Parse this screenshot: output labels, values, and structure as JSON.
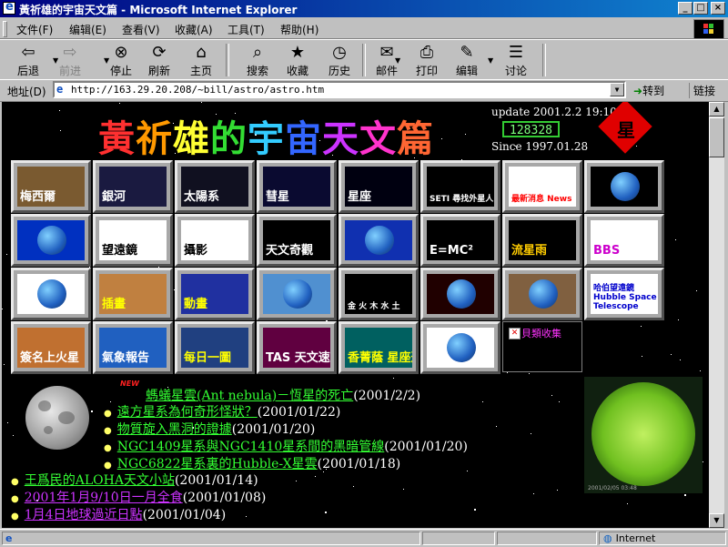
{
  "window": {
    "title": "黃祈雄的宇宙天文篇 - Microsoft Internet Explorer",
    "controls": [
      "_",
      "□",
      "×"
    ]
  },
  "menu": [
    "文件(F)",
    "编辑(E)",
    "查看(V)",
    "收藏(A)",
    "工具(T)",
    "帮助(H)"
  ],
  "toolbar": [
    {
      "label": "后退",
      "icon": "back-arrow-icon",
      "glyph": "⇦",
      "disabled": false
    },
    {
      "label": "前进",
      "icon": "forward-arrow-icon",
      "glyph": "⇨",
      "disabled": true
    },
    {
      "label": "停止",
      "icon": "stop-icon",
      "glyph": "⊗",
      "disabled": false
    },
    {
      "label": "刷新",
      "icon": "refresh-icon",
      "glyph": "⟳",
      "disabled": false
    },
    {
      "label": "主页",
      "icon": "home-icon",
      "glyph": "⌂",
      "disabled": false
    },
    {
      "label": "搜索",
      "icon": "search-icon",
      "glyph": "⌕",
      "disabled": false
    },
    {
      "label": "收藏",
      "icon": "favorites-icon",
      "glyph": "★",
      "disabled": false
    },
    {
      "label": "历史",
      "icon": "history-icon",
      "glyph": "◷",
      "disabled": false
    },
    {
      "label": "邮件",
      "icon": "mail-icon",
      "glyph": "✉",
      "disabled": false
    },
    {
      "label": "打印",
      "icon": "print-icon",
      "glyph": "⎙",
      "disabled": false
    },
    {
      "label": "编辑",
      "icon": "edit-icon",
      "glyph": "✎",
      "disabled": false
    },
    {
      "label": "讨论",
      "icon": "discuss-icon",
      "glyph": "☰",
      "disabled": false
    }
  ],
  "address": {
    "label": "地址(D)",
    "url": "http://163.29.20.208/~bill/astro/astro.htm",
    "go": "转到",
    "links": "链接"
  },
  "page": {
    "title_chars": [
      "黃",
      "祈",
      "雄",
      "的",
      "宇",
      "宙",
      "天",
      "文",
      "篇"
    ],
    "title_colors": [
      "#ff3030",
      "#ff9900",
      "#ffff33",
      "#33dd33",
      "#33ccff",
      "#3366ff",
      "#cc33ff",
      "#ff33cc",
      "#ff6633"
    ],
    "update": "update 2001.2.2 19:10",
    "counter": "128328",
    "since": "Since 1997.01.28",
    "badge_char": "星",
    "tiles": [
      {
        "label": "梅西爾",
        "bg": "#7a5a30",
        "fg": "#ffffff"
      },
      {
        "label": "銀河",
        "bg": "#1a1a40",
        "fg": "#ffffff"
      },
      {
        "label": "太陽系",
        "bg": "#101020",
        "fg": "#ffffff"
      },
      {
        "label": "彗星",
        "bg": "#0a0a30",
        "fg": "#ffffff"
      },
      {
        "label": "星座",
        "bg": "#000010",
        "fg": "#ffffff"
      },
      {
        "label": "SETI 尋找外星人",
        "bg": "#000000",
        "fg": "#ffffff"
      },
      {
        "label": "最新消息 News",
        "bg": "#ffffff",
        "fg": "#ff0000"
      },
      {
        "label": "",
        "bg": "#000000",
        "fg": "#ffffff"
      },
      {
        "label": "",
        "bg": "#0030c0",
        "fg": "#ffffff"
      },
      {
        "label": "望遠鏡",
        "bg": "#ffffff",
        "fg": "#000000"
      },
      {
        "label": "攝影",
        "bg": "#ffffff",
        "fg": "#000000"
      },
      {
        "label": "天文奇觀",
        "bg": "#000000",
        "fg": "#ffffff"
      },
      {
        "label": "",
        "bg": "#1030b0",
        "fg": "#ffffff"
      },
      {
        "label": "E=MC²",
        "bg": "#000000",
        "fg": "#ffffff"
      },
      {
        "label": "流星雨",
        "bg": "#000000",
        "fg": "#ffcc00"
      },
      {
        "label": "BBS",
        "bg": "#ffffff",
        "fg": "#cc00cc"
      },
      {
        "label": "",
        "bg": "#ffffff",
        "fg": "#000000"
      },
      {
        "label": "插畫",
        "bg": "#c08040",
        "fg": "#ffff00"
      },
      {
        "label": "動畫",
        "bg": "#2030a0",
        "fg": "#ffff00"
      },
      {
        "label": "",
        "bg": "#5090d0",
        "fg": "#ffffff"
      },
      {
        "label": "金 火 木 水 土",
        "bg": "#000000",
        "fg": "#ffffff"
      },
      {
        "label": "",
        "bg": "#200000",
        "fg": "#ffffff"
      },
      {
        "label": "",
        "bg": "#806040",
        "fg": "#ffffff"
      },
      {
        "label": "哈伯望遠鏡 Hubble Space Telescope",
        "bg": "#ffffff",
        "fg": "#0000cc"
      },
      {
        "label": "簽名上火星",
        "bg": "#c07030",
        "fg": "#ffffff"
      },
      {
        "label": "氣象報告",
        "bg": "#2060c0",
        "fg": "#ffffff"
      },
      {
        "label": "每日一圖",
        "bg": "#204080",
        "fg": "#ffff00"
      },
      {
        "label": "TAS 天文速報",
        "bg": "#600040",
        "fg": "#ffffff"
      },
      {
        "label": "香菁蔭 星座運勢",
        "bg": "#006060",
        "fg": "#ffff00"
      },
      {
        "label": "",
        "bg": "#ffffff",
        "fg": "#000000"
      }
    ],
    "broken_image_text": "貝類收集",
    "news": [
      {
        "title": "螞蟻星雲(Ant nebula)－恆星的死亡",
        "date": "(2001/2/2)",
        "color": "#33ff33",
        "is_new": true
      },
      {
        "title": "遠方星系為何奇形怪狀？",
        "date": "(2001/01/22)",
        "color": "#33ff33",
        "is_new": false
      },
      {
        "title": "物質旋入黑洞的證據",
        "date": "(2001/01/20)",
        "color": "#33ff33",
        "is_new": false
      },
      {
        "title": "NGC1409星系與NGC1410星系間的黑暗管線",
        "date": "(2001/01/20)",
        "color": "#33ff33",
        "is_new": false
      },
      {
        "title": "NGC6822星系裏的Hubble-X星雲",
        "date": "(2001/01/18)",
        "color": "#33ff33",
        "is_new": false
      },
      {
        "title": "王爲民的ALOHA天文小站",
        "date": "(2001/01/14)",
        "color": "#33ff33",
        "is_new": false
      },
      {
        "title": "2001年1月9/10日一月全食",
        "date": "(2001/01/08)",
        "color": "#cc33ff",
        "is_new": false
      },
      {
        "title": "1月4日地球過近日點",
        "date": "(2001/01/04)",
        "color": "#cc33ff",
        "is_new": false
      }
    ],
    "new_badge": "NEW",
    "sun_timestamp": "2001/02/05 03:48"
  },
  "status": {
    "left": "",
    "zone": "Internet"
  }
}
